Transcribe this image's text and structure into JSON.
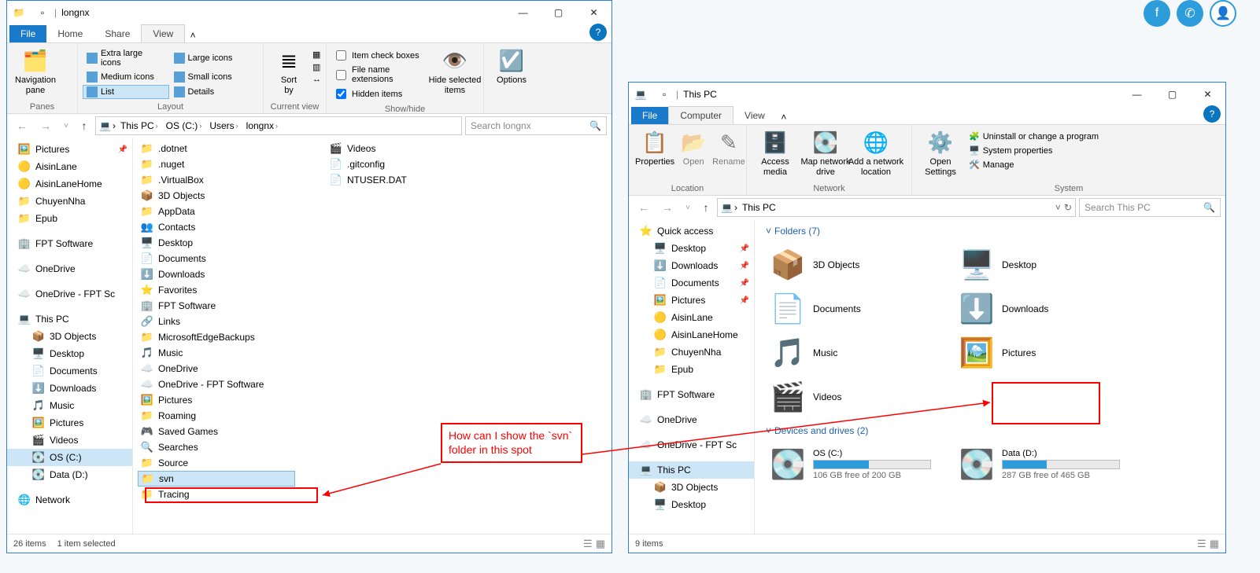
{
  "annotation": {
    "text": "How can I show the `svn` folder in this spot"
  },
  "win1": {
    "title": "longnx",
    "tabs": {
      "file": "File",
      "home": "Home",
      "share": "Share",
      "view": "View"
    },
    "ribbon": {
      "panes": {
        "nav": "Navigation\npane",
        "label": "Panes"
      },
      "layout": {
        "label": "Layout",
        "items": [
          "Extra large icons",
          "Large icons",
          "Medium icons",
          "Small icons",
          "List",
          "Details"
        ],
        "selected": "List"
      },
      "currentview": {
        "sort": "Sort\nby",
        "label": "Current view"
      },
      "showhide": {
        "c1": "Item check boxes",
        "c2": "File name extensions",
        "c3": "Hidden items",
        "btn": "Hide selected\nitems",
        "label": "Show/hide"
      },
      "options": {
        "btn": "Options"
      }
    },
    "crumbs": [
      "This PC",
      "OS (C:)",
      "Users",
      "longnx"
    ],
    "search_placeholder": "Search longnx",
    "nav": [
      {
        "t": "Pictures",
        "ic": "🖼️",
        "pin": true
      },
      {
        "t": "AisinLane",
        "ic": "🟡"
      },
      {
        "t": "AisinLaneHome",
        "ic": "🟡"
      },
      {
        "t": "ChuyenNha",
        "ic": "📁"
      },
      {
        "t": "Epub",
        "ic": "📁"
      },
      {
        "t": "FPT Software",
        "ic": "🏢",
        "sp": true
      },
      {
        "t": "OneDrive",
        "ic": "☁️",
        "sp": true
      },
      {
        "t": "OneDrive - FPT Sc",
        "ic": "☁️",
        "sp": true
      },
      {
        "t": "This PC",
        "ic": "💻",
        "sp": true
      },
      {
        "t": "3D Objects",
        "ic": "📦",
        "ind": true
      },
      {
        "t": "Desktop",
        "ic": "🖥️",
        "ind": true
      },
      {
        "t": "Documents",
        "ic": "📄",
        "ind": true
      },
      {
        "t": "Downloads",
        "ic": "⬇️",
        "ind": true
      },
      {
        "t": "Music",
        "ic": "🎵",
        "ind": true
      },
      {
        "t": "Pictures",
        "ic": "🖼️",
        "ind": true
      },
      {
        "t": "Videos",
        "ic": "🎬",
        "ind": true
      },
      {
        "t": "OS (C:)",
        "ic": "💽",
        "ind": true,
        "sel": true
      },
      {
        "t": "Data (D:)",
        "ic": "💽",
        "ind": true
      },
      {
        "t": "Network",
        "ic": "🌐",
        "sp": true
      }
    ],
    "col1": [
      {
        "t": ".dotnet",
        "ic": "📁"
      },
      {
        "t": ".nuget",
        "ic": "📁"
      },
      {
        "t": ".VirtualBox",
        "ic": "📁"
      },
      {
        "t": "3D Objects",
        "ic": "📦"
      },
      {
        "t": "AppData",
        "ic": "📁"
      },
      {
        "t": "Contacts",
        "ic": "👥"
      },
      {
        "t": "Desktop",
        "ic": "🖥️"
      },
      {
        "t": "Documents",
        "ic": "📄"
      },
      {
        "t": "Downloads",
        "ic": "⬇️"
      },
      {
        "t": "Favorites",
        "ic": "⭐"
      },
      {
        "t": "FPT Software",
        "ic": "🏢"
      },
      {
        "t": "Links",
        "ic": "🔗"
      },
      {
        "t": "MicrosoftEdgeBackups",
        "ic": "📁"
      },
      {
        "t": "Music",
        "ic": "🎵"
      },
      {
        "t": "OneDrive",
        "ic": "☁️"
      },
      {
        "t": "OneDrive - FPT Software",
        "ic": "☁️"
      },
      {
        "t": "Pictures",
        "ic": "🖼️"
      },
      {
        "t": "Roaming",
        "ic": "📁"
      },
      {
        "t": "Saved Games",
        "ic": "🎮"
      },
      {
        "t": "Searches",
        "ic": "🔍"
      },
      {
        "t": "Source",
        "ic": "📁"
      },
      {
        "t": "svn",
        "ic": "📁",
        "sel": true
      },
      {
        "t": "Tracing",
        "ic": "📁"
      }
    ],
    "col2": [
      {
        "t": "Videos",
        "ic": "🎬"
      },
      {
        "t": ".gitconfig",
        "ic": "📄"
      },
      {
        "t": "NTUSER.DAT",
        "ic": "📄"
      }
    ],
    "status": {
      "items": "26 items",
      "sel": "1 item selected"
    }
  },
  "win2": {
    "title": "This PC",
    "tabs": {
      "file": "File",
      "computer": "Computer",
      "view": "View"
    },
    "ribbon": {
      "location": {
        "props": "Properties",
        "open": "Open",
        "rename": "Rename",
        "label": "Location"
      },
      "network": {
        "access": "Access\nmedia",
        "map": "Map network\ndrive",
        "add": "Add a network\nlocation",
        "label": "Network"
      },
      "system": {
        "open": "Open\nSettings",
        "a": "Uninstall or change a program",
        "b": "System properties",
        "c": "Manage",
        "label": "System"
      }
    },
    "crumb": "This PC",
    "search_placeholder": "Search This PC",
    "nav": [
      {
        "t": "Quick access",
        "ic": "⭐"
      },
      {
        "t": "Desktop",
        "ic": "🖥️",
        "ind": true,
        "pin": true
      },
      {
        "t": "Downloads",
        "ic": "⬇️",
        "ind": true,
        "pin": true
      },
      {
        "t": "Documents",
        "ic": "📄",
        "ind": true,
        "pin": true
      },
      {
        "t": "Pictures",
        "ic": "🖼️",
        "ind": true,
        "pin": true
      },
      {
        "t": "AisinLane",
        "ic": "🟡",
        "ind": true
      },
      {
        "t": "AisinLaneHome",
        "ic": "🟡",
        "ind": true
      },
      {
        "t": "ChuyenNha",
        "ic": "📁",
        "ind": true
      },
      {
        "t": "Epub",
        "ic": "📁",
        "ind": true
      },
      {
        "t": "FPT Software",
        "ic": "🏢",
        "sp": true
      },
      {
        "t": "OneDrive",
        "ic": "☁️",
        "sp": true
      },
      {
        "t": "OneDrive - FPT Sc",
        "ic": "☁️",
        "sp": true
      },
      {
        "t": "This PC",
        "ic": "💻",
        "sel": true,
        "sp": true
      },
      {
        "t": "3D Objects",
        "ic": "📦",
        "ind": true
      },
      {
        "t": "Desktop",
        "ic": "🖥️",
        "ind": true
      }
    ],
    "folders_hdr": "Folders (7)",
    "folders": [
      {
        "t": "3D Objects",
        "ic": "📦"
      },
      {
        "t": "Desktop",
        "ic": "🖥️"
      },
      {
        "t": "Documents",
        "ic": "📄"
      },
      {
        "t": "Downloads",
        "ic": "⬇️"
      },
      {
        "t": "Music",
        "ic": "🎵"
      },
      {
        "t": "Pictures",
        "ic": "🖼️"
      },
      {
        "t": "Videos",
        "ic": "🎬"
      }
    ],
    "drives_hdr": "Devices and drives (2)",
    "drives": [
      {
        "t": "OS (C:)",
        "sub": "106 GB free of 200 GB",
        "pct": 47
      },
      {
        "t": "Data (D:)",
        "sub": "287 GB free of 465 GB",
        "pct": 38
      }
    ],
    "status": {
      "items": "9 items"
    }
  }
}
